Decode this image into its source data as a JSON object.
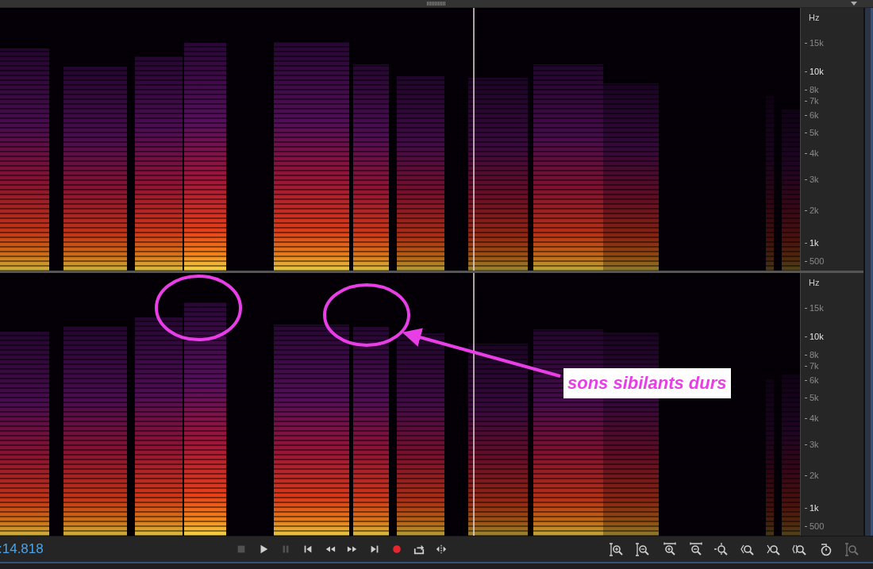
{
  "channels": [
    {
      "axis": {
        "unit": "Hz",
        "ticks": [
          {
            "label": "15k",
            "major": false
          },
          {
            "label": "10k",
            "major": true
          },
          {
            "label": "8k",
            "major": false
          },
          {
            "label": "7k",
            "major": false
          },
          {
            "label": "6k",
            "major": false
          },
          {
            "label": "5k",
            "major": false
          },
          {
            "label": "4k",
            "major": false
          },
          {
            "label": "3k",
            "major": false
          },
          {
            "label": "2k",
            "major": false
          },
          {
            "label": "1k",
            "major": true
          },
          {
            "label": "500",
            "major": false
          }
        ]
      }
    },
    {
      "axis": {
        "unit": "Hz",
        "ticks": [
          {
            "label": "15k",
            "major": false
          },
          {
            "label": "10k",
            "major": true
          },
          {
            "label": "8k",
            "major": false
          },
          {
            "label": "7k",
            "major": false
          },
          {
            "label": "6k",
            "major": false
          },
          {
            "label": "5k",
            "major": false
          },
          {
            "label": "4k",
            "major": false
          },
          {
            "label": "3k",
            "major": false
          },
          {
            "label": "2k",
            "major": false
          },
          {
            "label": "1k",
            "major": true
          },
          {
            "label": "500",
            "major": false
          }
        ]
      },
      "annotation": {
        "label": "sons sibilants durs"
      }
    }
  ],
  "time": ":14.818",
  "transport": [
    {
      "kind": "stop",
      "disabled": true
    },
    {
      "kind": "play",
      "disabled": false
    },
    {
      "kind": "pause",
      "disabled": true
    },
    {
      "kind": "to-start",
      "disabled": false
    },
    {
      "kind": "rewind",
      "disabled": false
    },
    {
      "kind": "forward",
      "disabled": false
    },
    {
      "kind": "to-end",
      "disabled": false
    },
    {
      "kind": "record",
      "disabled": false
    },
    {
      "kind": "loop",
      "disabled": false
    },
    {
      "kind": "skip",
      "disabled": false
    }
  ],
  "zoom_tools": [
    {
      "kind": "zoom-in-amp",
      "disabled": false
    },
    {
      "kind": "zoom-out-amp",
      "disabled": false
    },
    {
      "kind": "zoom-in-time",
      "disabled": false
    },
    {
      "kind": "zoom-out-time",
      "disabled": false
    },
    {
      "kind": "zoom-full",
      "disabled": false
    },
    {
      "kind": "zoom-in-point",
      "disabled": false
    },
    {
      "kind": "zoom-out-point",
      "disabled": false
    },
    {
      "kind": "zoom-selection",
      "disabled": false
    },
    {
      "kind": "history",
      "disabled": false
    },
    {
      "kind": "zoom-reset",
      "disabled": true
    }
  ]
}
